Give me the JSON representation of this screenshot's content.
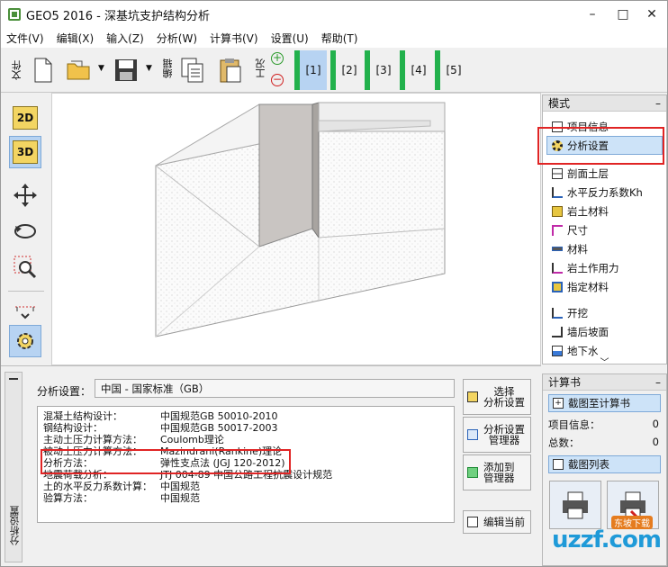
{
  "window": {
    "title": "GEO5 2016 - 深基坑支护结构分析",
    "minimize": "–",
    "maximize": "□",
    "close": "✕"
  },
  "menu": [
    "文件(V)",
    "编辑(X)",
    "输入(Z)",
    "分析(W)",
    "计算书(V)",
    "设置(U)",
    "帮助(T)"
  ],
  "toolbar": {
    "file_label": "文件",
    "edit_label": "编辑",
    "tool_label": "工况",
    "plus": "+",
    "minus": "−",
    "stages": [
      "[1]",
      "[2]",
      "[3]",
      "[4]",
      "[5]"
    ],
    "active_stage": "[1]"
  },
  "lefttools": {
    "btn_2d": "2D",
    "btn_3d": "3D"
  },
  "modes": {
    "header": "模式",
    "collapse": "–",
    "items": [
      "项目信息",
      "分析设置",
      "剖面土层",
      "水平反力系数Kh",
      "岩土材料",
      "尺寸",
      "材料",
      "岩土作用力",
      "指定材料",
      "开挖",
      "墙后坡面",
      "地下水"
    ],
    "selected": "分析设置",
    "more": "﹀"
  },
  "calcbook": {
    "header": "计算书",
    "collapse": "–",
    "save_view": "截图至计算书",
    "project_info_label": "项目信息：",
    "project_info_value": "0",
    "total_label": "总数：",
    "total_value": "0",
    "screenshot_list": "截图列表"
  },
  "bottom": {
    "tab_label": "分析设置",
    "settings_label": "分析设置：",
    "settings_value": "中国 - 国家标准（GB）",
    "rows": [
      {
        "k": "混凝土结构设计：",
        "v": "中国规范GB 50010-2010"
      },
      {
        "k": "钢结构设计：",
        "v": "中国规范GB 50017-2003"
      },
      {
        "k": "主动土压力计算方法：",
        "v": "Coulomb理论"
      },
      {
        "k": "被动土压力计算方法：",
        "v": "Mazindrani(Rankine)理论"
      },
      {
        "k": "分析方法：",
        "v": "弹性支点法 (JGJ 120-2012)"
      },
      {
        "k": "地震荷载分析：",
        "v": "JTJ 004-89 中国公路工程抗震设计规范"
      },
      {
        "k": "土的水平反力系数计算：",
        "v": "中国规范"
      },
      {
        "k": "验算方法：",
        "v": "中国规范"
      }
    ],
    "btn_select": "选择\n分析设置",
    "btn_manage": "分析设置\n管理器",
    "btn_add": "添加到\n管理器",
    "btn_edit": "编辑当前"
  },
  "watermark": {
    "brand": "uzzf.com",
    "sub": "东坡下载"
  },
  "colors": {
    "stage_green": "#22b14c",
    "highlight": "#e02424",
    "selection": "#cde3f8"
  }
}
